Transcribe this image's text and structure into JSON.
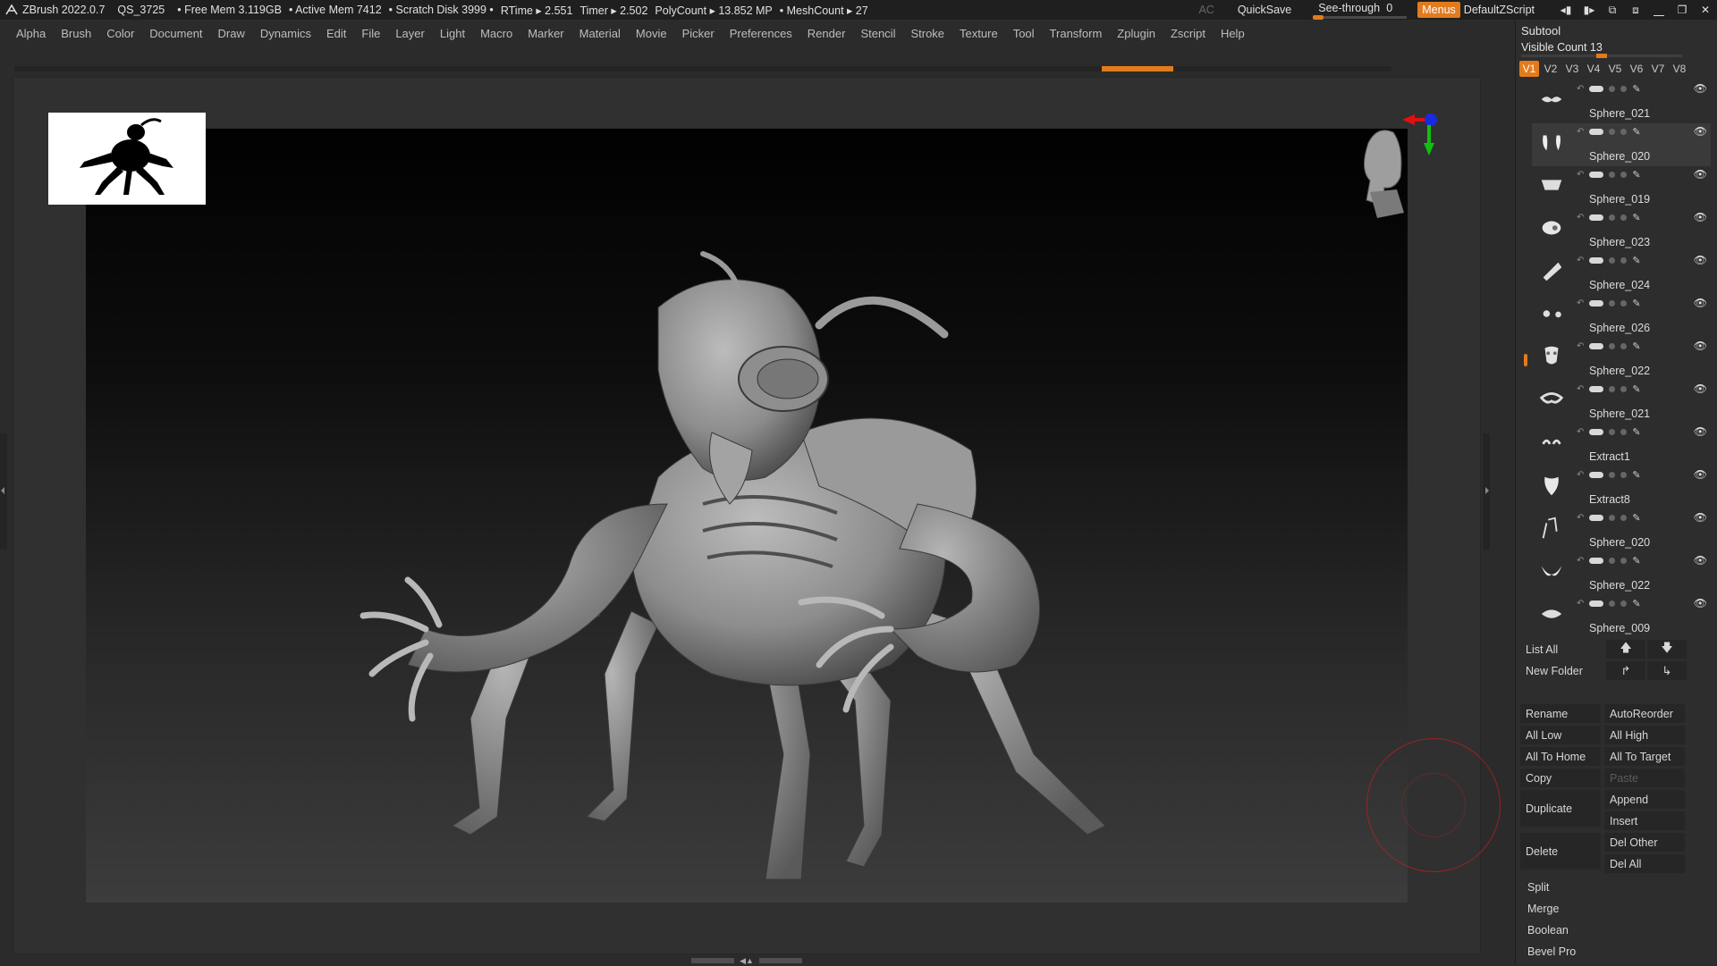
{
  "titlebar": {
    "app": "ZBrush 2022.0.7",
    "project": "QS_3725",
    "free_mem": "• Free Mem 3.119GB",
    "active_mem": "• Active Mem 7412",
    "scratch": "• Scratch Disk 3999 •",
    "rtime": "RTime ▸ 2.551",
    "timer": "Timer ▸ 2.502",
    "polycount": "PolyCount ▸ 13.852 MP",
    "meshcount": "• MeshCount ▸ 27",
    "ac": "AC",
    "quicksave": "QuickSave",
    "see_through_label": "See-through",
    "see_through_value": "0",
    "menus": "Menus",
    "zscript": "DefaultZScript"
  },
  "menubar": [
    "Alpha",
    "Brush",
    "Color",
    "Document",
    "Draw",
    "Dynamics",
    "Edit",
    "File",
    "Layer",
    "Light",
    "Macro",
    "Marker",
    "Material",
    "Movie",
    "Picker",
    "Preferences",
    "Render",
    "Stencil",
    "Stroke",
    "Texture",
    "Tool",
    "Transform",
    "Zplugin",
    "Zscript",
    "Help"
  ],
  "panel": {
    "title": "Subtool",
    "visible_count": "Visible Count 13",
    "visible_slider": 0.5,
    "versions": [
      "V1",
      "V2",
      "V3",
      "V4",
      "V5",
      "V6",
      "V7",
      "V8"
    ],
    "active_version": "V1",
    "subtools": [
      {
        "name": "Sphere_021",
        "thumb": "mustache-icon",
        "selected": false
      },
      {
        "name": "Sphere_020",
        "thumb": "fang-pair-icon",
        "selected": true
      },
      {
        "name": "Sphere_019",
        "thumb": "plate-icon",
        "selected": false
      },
      {
        "name": "Sphere_023",
        "thumb": "blob-icon",
        "selected": false
      },
      {
        "name": "Sphere_024",
        "thumb": "blade-icon",
        "selected": false
      },
      {
        "name": "Sphere_026",
        "thumb": "dots-icon",
        "selected": false
      },
      {
        "name": "Sphere_022",
        "thumb": "eyes-icon",
        "selected": false
      },
      {
        "name": "Sphere_021",
        "thumb": "skull-icon",
        "selected": false
      },
      {
        "name": "Extract1",
        "thumb": "ring-icon",
        "selected": false
      },
      {
        "name": "Extract8",
        "thumb": "horns-icon",
        "selected": false
      },
      {
        "name": "Sphere_020",
        "thumb": "shield-icon",
        "selected": false
      },
      {
        "name": "Sphere_022",
        "thumb": "claws-icon",
        "selected": false
      },
      {
        "name": "Sphere_009",
        "thumb": "wings-icon",
        "selected": false
      }
    ],
    "buttons": {
      "list_all": "List All",
      "new_folder": "New Folder",
      "rename": "Rename",
      "autoreorder": "AutoReorder",
      "all_low": "All Low",
      "all_high": "All High",
      "all_to_home": "All To Home",
      "all_to_target": "All To Target",
      "copy": "Copy",
      "paste": "Paste",
      "duplicate": "Duplicate",
      "append": "Append",
      "insert": "Insert",
      "delete": "Delete",
      "del_other": "Del Other",
      "del_all": "Del All",
      "split": "Split",
      "merge": "Merge",
      "boolean": "Boolean",
      "bevel_pro": "Bevel Pro"
    }
  },
  "colors": {
    "accent": "#e27b1d",
    "ui_bg": "#2b2b2b",
    "panel_bg": "#2d2d2d"
  }
}
